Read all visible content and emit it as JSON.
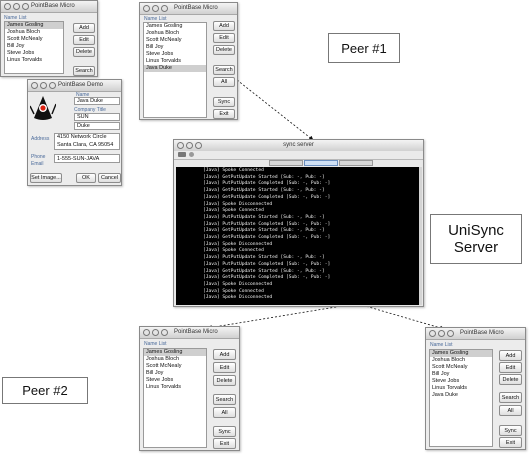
{
  "callouts": {
    "peer1": "Peer #1",
    "server_line1": "UniSync",
    "server_line2": "Server",
    "peer2": "Peer #2"
  },
  "peer1_window": {
    "title": "PointBase Micro",
    "list_label": "Name List",
    "names": [
      "James Gosling",
      "Joshua Bloch",
      "Scott McNealy",
      "Bill Joy",
      "Steve Jobs",
      "Linus Torvalds",
      "Java Duke"
    ],
    "buttons": [
      "Add",
      "Edit",
      "Delete",
      "Search",
      "All",
      "Sync",
      "Exit"
    ]
  },
  "demo_list_window": {
    "title": "PointBase Micro",
    "list_label": "Name List",
    "names": [
      "James Gosling",
      "Joshua Bloch",
      "Scott McNealy",
      "Bill Joy",
      "Steve Jobs",
      "Linus Torvalds"
    ],
    "buttons": [
      "Add",
      "Edit",
      "Delete",
      "Search"
    ]
  },
  "demo_form_window": {
    "title": "PointBase Demo",
    "labels": [
      "Name",
      "Company Title",
      "Address",
      "Phone",
      "Email"
    ],
    "name_value": "Java Duke",
    "company_value": "SUN",
    "title_value": "Duke",
    "address_line1": "4150 Network Circle",
    "address_line2": "Santa Clara, CA 95054",
    "phone_value": "1-555-SUN-JAVA",
    "buttons": [
      "Set Image...",
      "OK",
      "Cancel"
    ]
  },
  "server_window": {
    "title": "sync server",
    "lines": [
      "[Java] Spoke Connected",
      "[Java] GetPutUpdate Started [Sub: -, Pub: -]",
      "[Java] PutPutUpdate Completed [Sub: -, Pub: -]",
      "[Java] GetPutUpdate Started [Sub: -, Pub: -]",
      "[Java] GetPutUpdate Completed [Sub: -, Pub: -]",
      "[Java] Spoke Disconnected",
      "[Java] Spoke Connected",
      "[Java] PutPutUpdate Started [Sub: -, Pub: -]",
      "[Java] PutPutUpdate Completed [Sub: -, Pub: -]",
      "[Java] GetPutUpdate Started [Sub: -, Pub: -]",
      "[Java] GetPutUpdate Completed [Sub: -, Pub: -]",
      "[Java] Spoke Disconnected",
      "[Java] Spoke Connected",
      "[Java] PutPutUpdate Started [Sub: -, Pub: -]",
      "[Java] PutPutUpdate Completed [Sub: -, Pub: -]",
      "[Java] GetPutUpdate Started [Sub: -, Pub: -]",
      "[Java] GetPutUpdate Completed [Sub: -, Pub: -]",
      "[Java] Spoke Disconnected",
      "[Java] Spoke Connected",
      "[Java] Spoke Disconnected"
    ]
  },
  "peer2_window": {
    "title": "PointBase Micro",
    "list_label": "Name List",
    "names": [
      "James Gosling",
      "Joshua Bloch",
      "Scott McNealy",
      "Bill Joy",
      "Steve Jobs",
      "Linus Torvalds"
    ],
    "buttons": [
      "Add",
      "Edit",
      "Delete",
      "Search",
      "All",
      "Sync",
      "Exit"
    ]
  },
  "peer3_window": {
    "title": "PointBase Micro",
    "list_label": "Name List",
    "names": [
      "James Gosling",
      "Joshua Bloch",
      "Scott McNealy",
      "Bill Joy",
      "Steve Jobs",
      "Linus Torvalds",
      "Java Duke"
    ],
    "buttons": [
      "Add",
      "Edit",
      "Delete",
      "Search",
      "All",
      "Sync",
      "Exit"
    ]
  }
}
